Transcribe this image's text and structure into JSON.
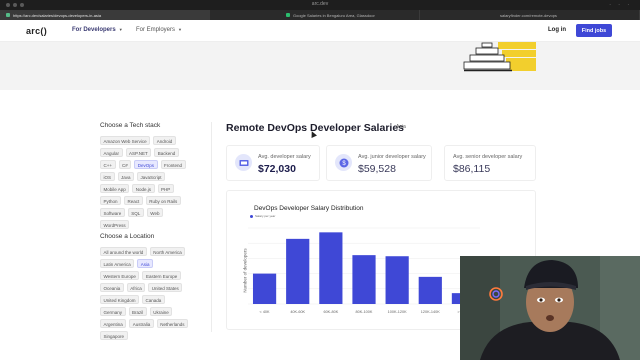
{
  "browser": {
    "window_title": "arc.dev",
    "tabs": [
      {
        "label": "https://arc.dev/salaries/devops-developers-in-asia"
      },
      {
        "label": "Google Salaries in Bengaluru Area, Glassdoor"
      },
      {
        "label": "salaryfinder.com/remote-devops"
      }
    ]
  },
  "header": {
    "logo": "arc()",
    "nav": [
      {
        "label": "For Developers"
      },
      {
        "label": "For Employers"
      }
    ],
    "login_label": "Log in",
    "find_jobs_label": "Find jobs"
  },
  "sidebar": {
    "tech_title": "Choose a Tech stack",
    "tech": [
      "Amazon Web Service",
      "Android",
      "Angular",
      "ASP.NET",
      "Backend",
      "C++",
      "C#",
      "DevOps",
      "Frontend",
      "iOS",
      "Java",
      "JavaScript",
      "Mobile App",
      "Node.js",
      "PHP",
      "Python",
      "React",
      "Ruby on Rails",
      "Software",
      "SQL",
      "Web",
      "WordPress"
    ],
    "tech_selected": "DevOps",
    "location_title": "Choose a Location",
    "locations": [
      "All around the world",
      "North America",
      "Latin America",
      "Asia",
      "Western Europe",
      "Eastern Europe",
      "Oceania",
      "Africa",
      "United States",
      "United Kingdom",
      "Canada",
      "Germany",
      "Brazil",
      "Ukraine",
      "Argentina",
      "Australia",
      "Netherlands",
      "Singapore"
    ],
    "location_selected": "Asia"
  },
  "main": {
    "title": "Remote DevOps Developer Salaries",
    "region": "Asia",
    "stats": [
      {
        "label": "Avg. developer salary",
        "value": "$72,030"
      },
      {
        "label": "Avg. junior developer salary",
        "value": "$59,528"
      },
      {
        "label": "Avg. senior developer salary",
        "value": "$86,115"
      }
    ]
  },
  "chart_data": {
    "type": "bar",
    "title": "DevOps Developer Salary Distribution",
    "legend": [
      "Salary per year"
    ],
    "ylabel": "Number of developers",
    "xlabel": "",
    "categories": [
      "< 40K",
      "40K-60K",
      "60K-80K",
      "80K-100K",
      "100K-120K",
      "120K-140K",
      "> 140K"
    ],
    "values": [
      28,
      60,
      66,
      45,
      44,
      25,
      10
    ],
    "ylim": [
      0,
      70
    ],
    "grid": true,
    "color": "#3f48d6"
  },
  "colors": {
    "accent": "#3f48d6",
    "chip_selected_bg": "#e7e8ff"
  }
}
